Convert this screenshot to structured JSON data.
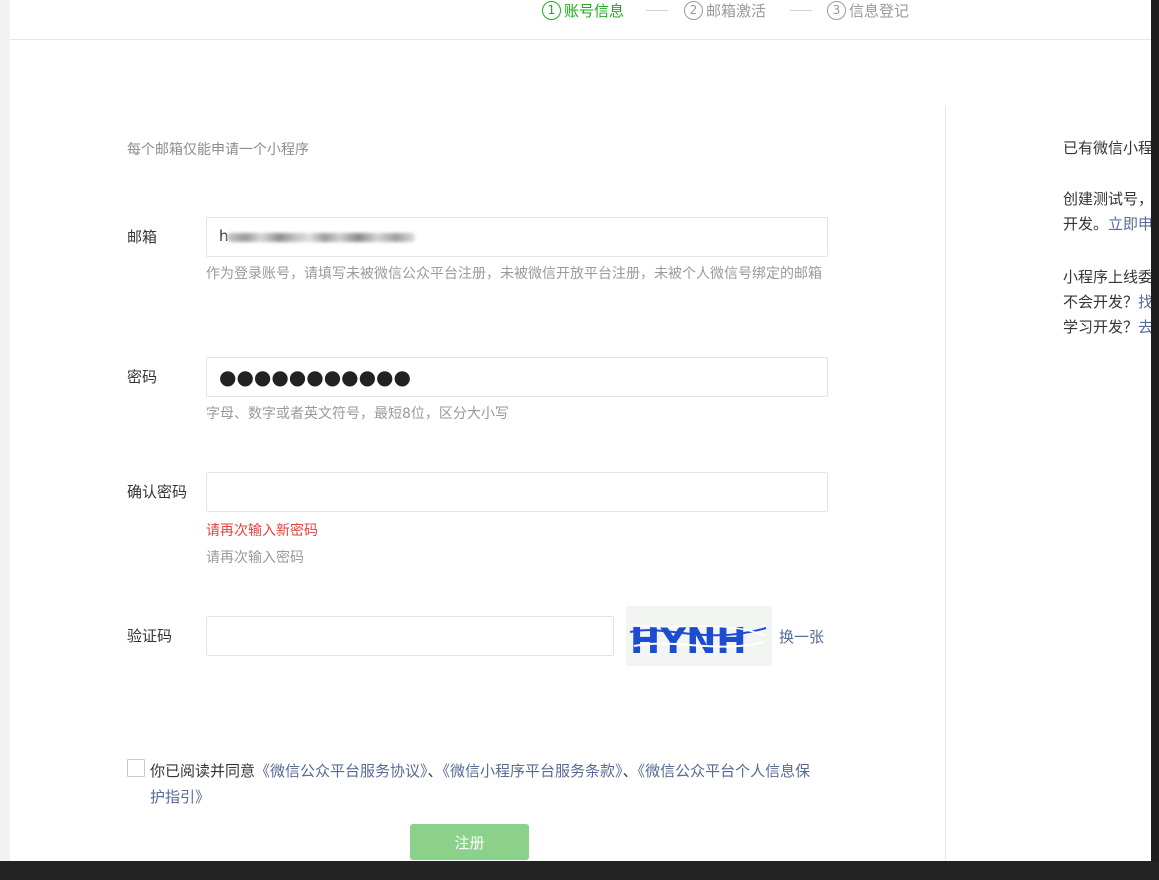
{
  "steps": [
    {
      "num": "1",
      "label": "账号信息",
      "active": true
    },
    {
      "num": "2",
      "label": "邮箱激活",
      "active": false
    },
    {
      "num": "3",
      "label": "信息登记",
      "active": false
    }
  ],
  "form": {
    "tip": "每个邮箱仅能申请一个小程序",
    "email": {
      "label": "邮箱",
      "value_prefix": "h",
      "hint": "作为登录账号，请填写未被微信公众平台注册，未被微信开放平台注册，未被个人微信号绑定的邮箱"
    },
    "password": {
      "label": "密码",
      "masked_value": "●●●●●●●●●●●",
      "hint": "字母、数字或者英文符号，最短8位，区分大小写"
    },
    "confirm": {
      "label": "确认密码",
      "error": "请再次输入新密码",
      "hint": "请再次输入密码"
    },
    "captcha": {
      "label": "验证码",
      "image_text": "HYNH",
      "refresh": "换一张"
    },
    "agreement": {
      "prefix": "你已阅读并同意",
      "link1": "《微信公众平台服务协议》",
      "sep1": "、",
      "link2": "《微信小程序平台服务条款》",
      "sep2": "、",
      "link3": "《微信公众平台个人信息保护指引》"
    },
    "submit": "注册"
  },
  "side": {
    "line1": "已有微信小程",
    "line2a": "创建测试号，",
    "line2b_plain": "开发。",
    "line2b_link": "立即申",
    "line3a": "小程序上线委",
    "line3b_plain": "不会开发？",
    "line3b_link": "找",
    "line3c_plain": "学习开发？",
    "line3c_link": "去"
  },
  "colors": {
    "accent": "#1aad19",
    "link": "#576b95",
    "error": "#e64340",
    "submit_disabled": "#8bd18a"
  }
}
